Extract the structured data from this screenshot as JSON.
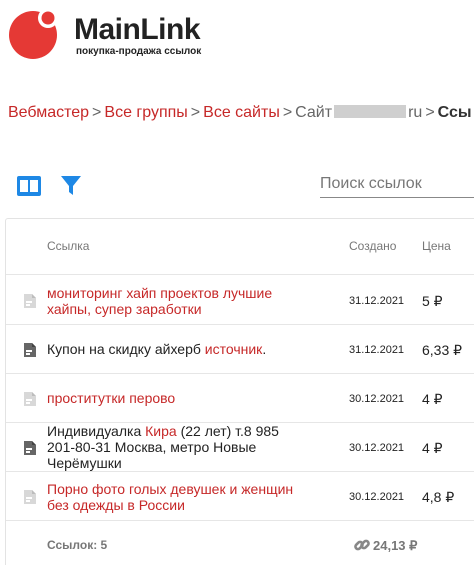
{
  "brand": {
    "name": "MainLink",
    "tagline": "покупка-продажа ссылок",
    "color": "#e53935"
  },
  "breadcrumb": {
    "item1": "Вебмастер",
    "item2": "Все группы",
    "item3": "Все сайты",
    "site_prefix": "Сайт",
    "site_suffix": "ru",
    "current": "Ссы",
    "separator": ">"
  },
  "toolbar": {
    "view_icon": "grid-view-icon",
    "filter_icon": "filter-icon",
    "accent": "#1e88e5",
    "search_placeholder": "Поиск ссылок"
  },
  "table": {
    "columns": {
      "link": "Ссылка",
      "created": "Создано",
      "price": "Цена"
    },
    "rows": [
      {
        "plain": "",
        "anchor": "мониторинг хайп проектов лучшие хайпы, супер заработки",
        "plain_after": "",
        "date": "31.12.2021",
        "price": "5 ₽"
      },
      {
        "plain": "Купон на скидку айхерб ",
        "anchor": "источник",
        "plain_after": ".",
        "date": "31.12.2021",
        "price": "6,33 ₽"
      },
      {
        "plain": "",
        "anchor": "проститутки перово",
        "plain_after": "",
        "date": "30.12.2021",
        "price": "4 ₽"
      },
      {
        "plain": "Индивидуалка ",
        "anchor": "Кира",
        "plain_after": " (22 лет) т.8 985 201-80-31 Москва, метро Новые Черёмушки",
        "date": "30.12.2021",
        "price": "4 ₽"
      },
      {
        "plain": "",
        "anchor": "Порно фото голых девушек и женщин без одежды в России",
        "plain_after": "",
        "date": "30.12.2021",
        "price": "4,8 ₽"
      }
    ],
    "footer": {
      "count_label": "Ссылок: 5",
      "total": "24,13 ₽",
      "total_icon": "link-icon"
    }
  }
}
